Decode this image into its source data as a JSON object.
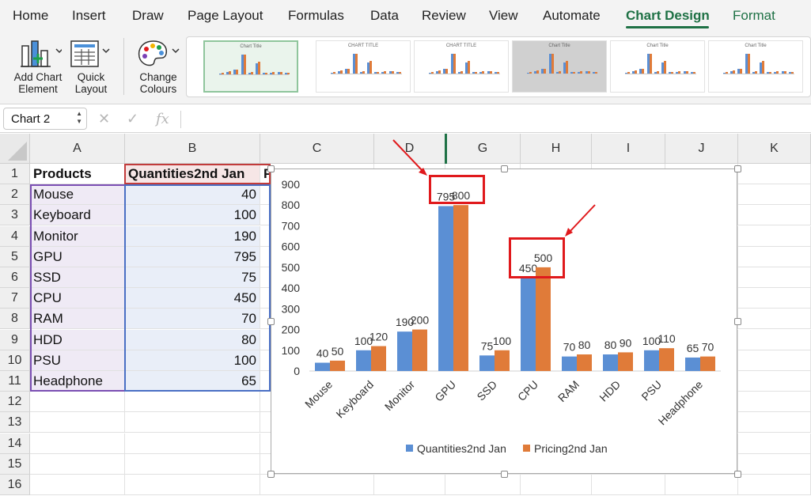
{
  "tabs": [
    "Home",
    "Insert",
    "Draw",
    "Page Layout",
    "Formulas",
    "Data",
    "Review",
    "View",
    "Automate",
    "Chart Design",
    "Format"
  ],
  "ribbon": {
    "add_chart_element": [
      "Add Chart",
      "Element"
    ],
    "quick_layout": [
      "Quick",
      "Layout"
    ],
    "change_colours": [
      "Change",
      "Colours"
    ],
    "gallery_titles": [
      "Chart Title",
      "CHART TITLE",
      "CHART TITLE",
      "Chart Title",
      "Chart Title",
      "Chart Title"
    ]
  },
  "formula_bar": {
    "name_box": "Chart 2",
    "cancel_icon": "✕",
    "enter_icon": "✓",
    "fx_icon": "fx",
    "formula": ""
  },
  "grid": {
    "columns": [
      "A",
      "B",
      "C",
      "D",
      "G",
      "H",
      "I",
      "J",
      "K"
    ],
    "rows": [
      "1",
      "2",
      "3",
      "4",
      "5",
      "6",
      "7",
      "8",
      "9",
      "10",
      "11",
      "12",
      "13",
      "14",
      "15",
      "16"
    ],
    "header_a": "Products",
    "header_b": "Quantities2nd Jan",
    "header_c_partial": "P",
    "products": [
      "Mouse",
      "Keyboard",
      "Monitor",
      "GPU",
      "SSD",
      "CPU",
      "RAM",
      "HDD",
      "PSU",
      "Headphone"
    ],
    "quantities": [
      "40",
      "100",
      "190",
      "795",
      "75",
      "450",
      "70",
      "80",
      "100",
      "65"
    ]
  },
  "chart_data": {
    "type": "bar",
    "title": "",
    "categories": [
      "Mouse",
      "Keyboard",
      "Monitor",
      "GPU",
      "SSD",
      "CPU",
      "RAM",
      "HDD",
      "PSU",
      "Headphone"
    ],
    "series": [
      {
        "name": "Quantities2nd Jan",
        "values": [
          40,
          100,
          190,
          795,
          75,
          450,
          70,
          80,
          100,
          65
        ],
        "color": "#5b8fd4"
      },
      {
        "name": "Pricing2nd Jan",
        "values": [
          50,
          120,
          200,
          800,
          100,
          500,
          80,
          90,
          110,
          70
        ],
        "color": "#e07b39"
      }
    ],
    "ylim": [
      0,
      900
    ],
    "yticks": [
      0,
      100,
      200,
      300,
      400,
      500,
      600,
      700,
      800,
      900
    ],
    "data_labels": true,
    "legend": "bottom",
    "grid": false
  },
  "annotation_color": "#e0191c"
}
